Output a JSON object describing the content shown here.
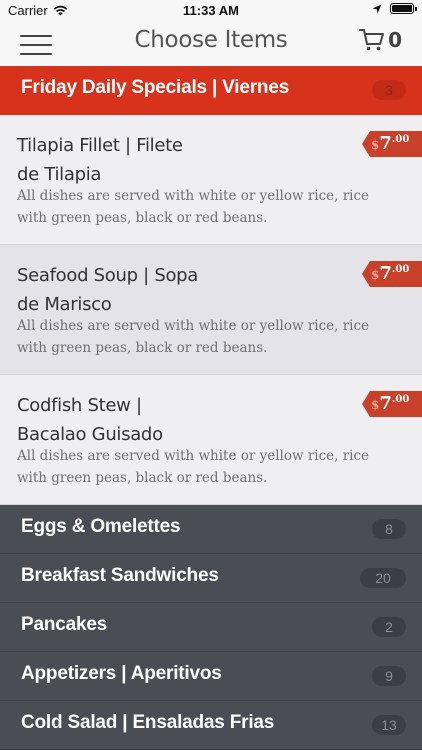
{
  "status_bar": {
    "carrier": "Carrier",
    "time": "11:33 AM",
    "icons": [
      "wifi-icon",
      "location-arrow-icon",
      "battery-icon"
    ]
  },
  "nav_bar": {
    "title": "Choose Items",
    "cart_count": "0",
    "icons": [
      "hamburger-menu-icon",
      "shopping-cart-icon"
    ]
  },
  "active_category": {
    "label": "Friday Daily Specials | Viernes",
    "count": "3",
    "color": "#d7321c"
  },
  "items": [
    {
      "name_line1": "Tilapia Fillet | Filete",
      "name_line2": "de Tilapia",
      "description": "All dishes are served with white or yellow rice, rice with green peas, black or red beans.",
      "price_currency": "$",
      "price_main": "7",
      "price_cents": ".00"
    },
    {
      "name_line1": "Seafood Soup | Sopa",
      "name_line2": "de Marisco",
      "description": "All dishes are served with white or yellow rice, rice with green peas, black or red beans.",
      "price_currency": "$",
      "price_main": "7",
      "price_cents": ".00"
    },
    {
      "name_line1": "Codfish Stew |",
      "name_line2": "Bacalao Guisado",
      "description": "All dishes are served with white or yellow rice, rice with green peas, black or red beans.",
      "price_currency": "$",
      "price_main": "7",
      "price_cents": ".00"
    }
  ],
  "categories": [
    {
      "label": "Eggs & Omelettes",
      "count": "8"
    },
    {
      "label": "Breakfast Sandwiches",
      "count": "20"
    },
    {
      "label": "Pancakes",
      "count": "2"
    },
    {
      "label": "Appetizers | Aperitivos",
      "count": "9"
    },
    {
      "label": "Cold Salad | Ensaladas Frias",
      "count": "13"
    }
  ],
  "colors": {
    "accent_red": "#d7321c",
    "price_tag": "#c8402a",
    "category_bg": "#4a4d53"
  }
}
